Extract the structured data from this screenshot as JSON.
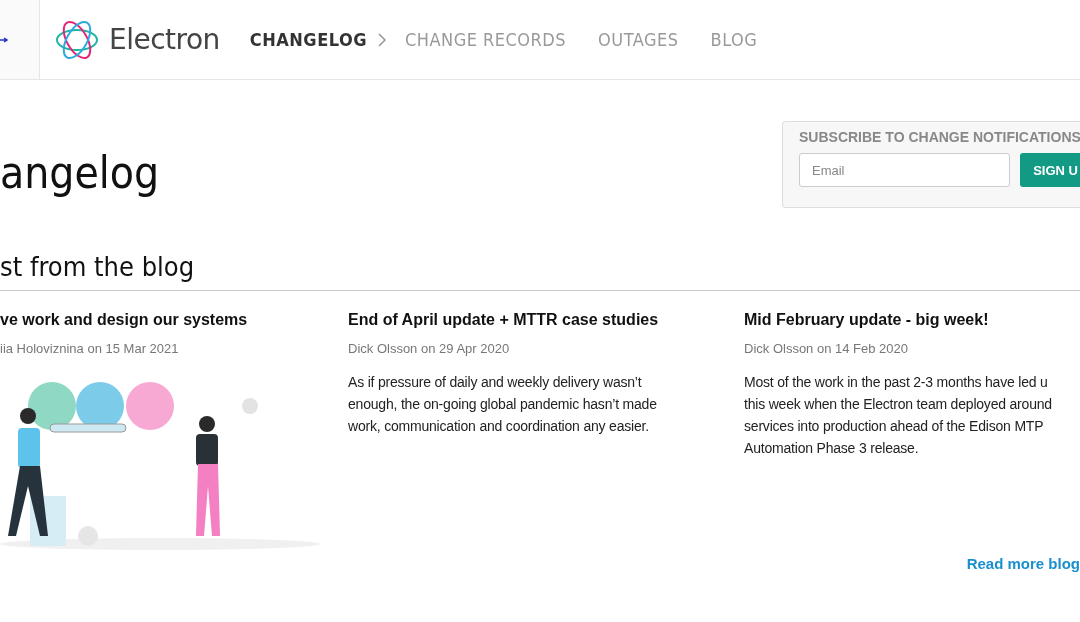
{
  "header": {
    "logo_text": "Electron",
    "nav": [
      {
        "label": "CHANGELOG",
        "selected": true
      },
      {
        "label": "CHANGE RECORDS",
        "selected": false
      },
      {
        "label": "OUTAGES",
        "selected": false
      },
      {
        "label": "BLOG",
        "selected": false
      }
    ]
  },
  "page_title": "angelog",
  "subscribe": {
    "title": "SUBSCRIBE TO CHANGE NOTIFICATIONS",
    "placeholder": "Email",
    "button": "SIGN U"
  },
  "blog": {
    "heading": "st from the blog",
    "posts": [
      {
        "title": "ve work and design our systems",
        "meta": "iia Holoviznina on 15 Mar 2021",
        "kind": "picture"
      },
      {
        "title": "End of April update + MTTR case studies",
        "meta": "Dick Olsson on 29 Apr 2020",
        "kind": "text",
        "excerpt": [
          "As if pressure of daily and weekly delivery wasn’t",
          "enough, the on-going global pandemic hasn’t made",
          "work, communication and coordination any easier."
        ]
      },
      {
        "title": "Mid February update - big week!",
        "meta": "Dick Olsson on 14 Feb 2020",
        "kind": "text",
        "excerpt": [
          "Most of the work in the past 2-3 months have led u",
          "this week when the Electron team deployed around",
          "services into production ahead of the Edison MTP",
          "Automation Phase 3 release."
        ]
      }
    ],
    "read_more": "Read more blog"
  }
}
